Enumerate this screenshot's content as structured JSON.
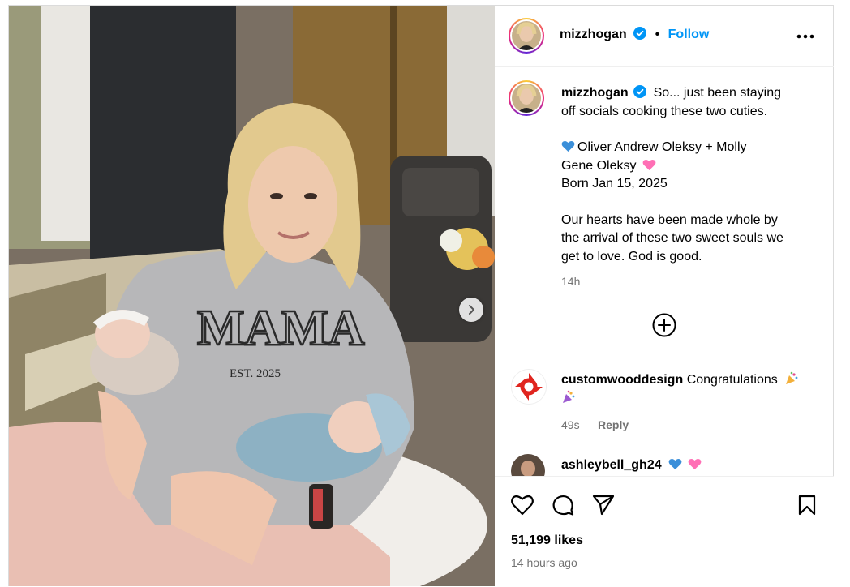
{
  "post": {
    "username": "mizzhogan",
    "follow_label": "Follow",
    "separator": "•"
  },
  "caption": {
    "username": "mizzhogan",
    "line1": "So... just been staying",
    "line2": "off socials cooking these two cuties.",
    "names_line1": "Oliver Andrew Oleksy + Molly",
    "names_line2": "Gene Oleksy",
    "born": "Born Jan 15, 2025",
    "para_line1": "Our hearts have been made whole by",
    "para_line2": "the arrival of these two sweet souls we",
    "para_line3": "get to love. God is good.",
    "time": "14h"
  },
  "comments": [
    {
      "username": "customwooddesign",
      "text": "Congratulations",
      "time": "49s",
      "reply_label": "Reply"
    },
    {
      "username": "ashleybell_gh24"
    }
  ],
  "footer": {
    "likes": "51,199 likes",
    "time_ago": "14 hours ago"
  },
  "colors": {
    "accent": "#0095f6",
    "muted": "#737373",
    "verified": "#0095f6",
    "blue_heart": "#3b8fd9",
    "pink_heart": "#ff6fb5"
  }
}
